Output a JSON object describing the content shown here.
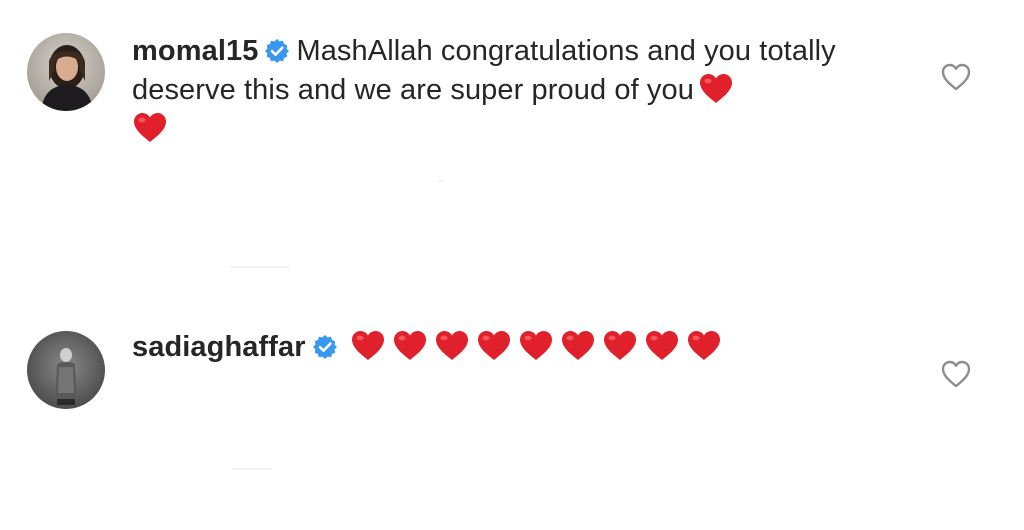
{
  "comments": [
    {
      "username": "momal15",
      "verified": true,
      "text": "MashAllah congratulations and you totally deserve this and we are super proud of you",
      "emoji_trailing": [
        "red-heart",
        "red-heart"
      ],
      "avatar_icon": "user-avatar-photo",
      "like_icon": "heart-outline-icon"
    },
    {
      "username": "sadiaghaffar",
      "verified": true,
      "text": "",
      "emoji_trailing": [
        "red-heart",
        "red-heart",
        "red-heart",
        "red-heart",
        "red-heart",
        "red-heart",
        "red-heart",
        "red-heart",
        "red-heart"
      ],
      "avatar_icon": "user-avatar-photo",
      "like_icon": "heart-outline-icon"
    }
  ],
  "colors": {
    "text": "#262626",
    "verified_badge": "#3897f0",
    "heart_emoji": "#e0202a",
    "like_outline": "#8e8e8e",
    "background": "#ffffff"
  }
}
